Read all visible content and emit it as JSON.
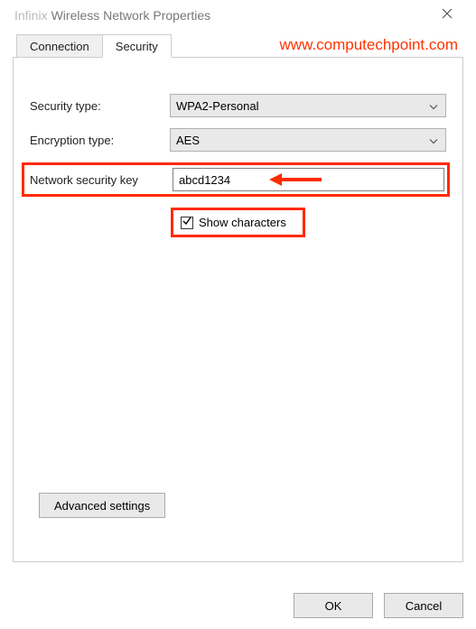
{
  "window": {
    "network_name": "Infinix",
    "title_suffix": "Wireless Network Properties"
  },
  "watermark": "www.computechpoint.com",
  "tabs": {
    "connection": "Connection",
    "security": "Security",
    "active": "security"
  },
  "form": {
    "security_type_label": "Security type:",
    "security_type_value": "WPA2-Personal",
    "encryption_type_label": "Encryption type:",
    "encryption_type_value": "AES",
    "network_key_label": "Network security key",
    "network_key_value": "abcd1234",
    "show_characters_label": "Show characters",
    "show_characters_checked": true
  },
  "buttons": {
    "advanced": "Advanced settings",
    "ok": "OK",
    "cancel": "Cancel"
  },
  "annotations": {
    "highlight_color": "#ff2a00"
  }
}
